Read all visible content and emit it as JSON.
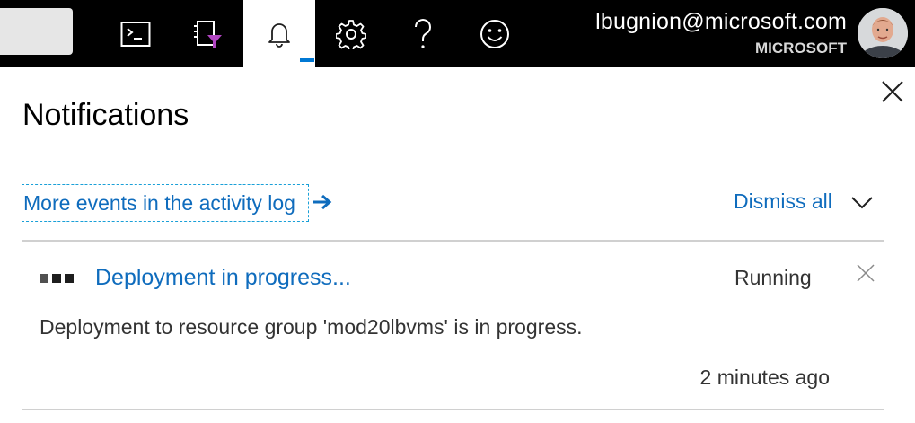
{
  "user": {
    "email": "lbugnion@microsoft.com",
    "org": "MICROSOFT"
  },
  "toolbar": {
    "icons": [
      "cloud-shell-icon",
      "directory-filter-icon",
      "bell-icon",
      "gear-icon",
      "help-icon",
      "smiley-icon"
    ],
    "active": "bell-icon"
  },
  "panel": {
    "title": "Notifications",
    "activity_link": "More events in the activity log",
    "dismiss_all": "Dismiss all"
  },
  "notifications": [
    {
      "title": "Deployment in progress...",
      "status": "Running",
      "description": "Deployment to resource group 'mod20lbvms' is in progress.",
      "time": "2 minutes ago"
    }
  ],
  "colors": {
    "topbar": "#000000",
    "link": "#0f6cbd",
    "accent": "#0078d4"
  }
}
